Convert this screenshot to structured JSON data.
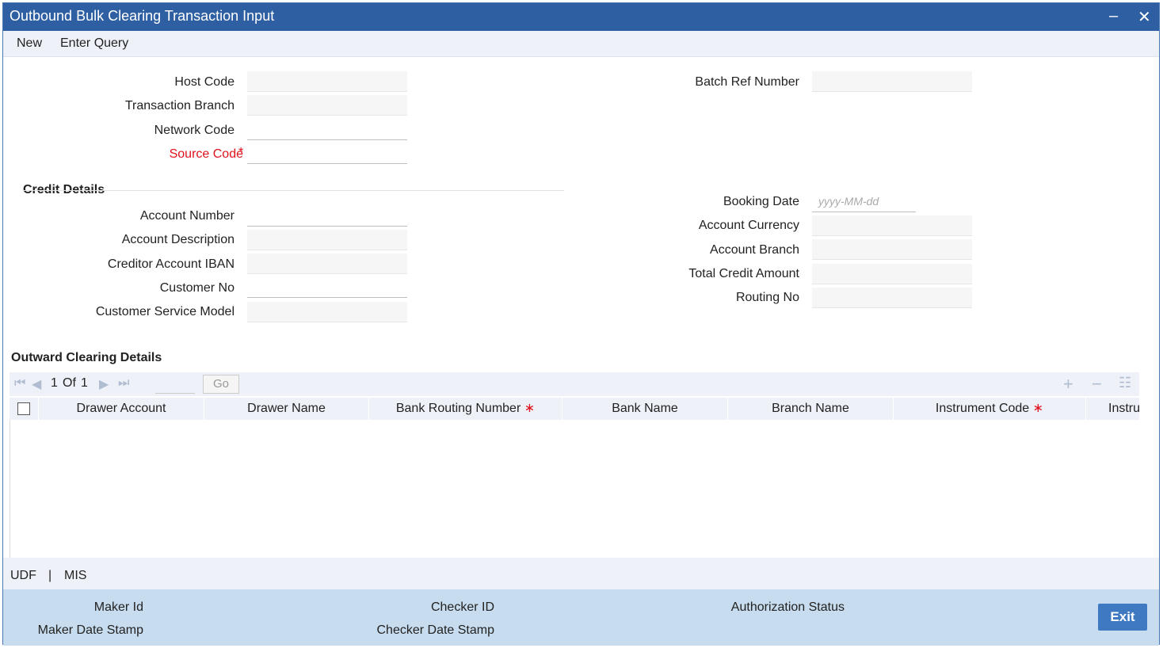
{
  "window": {
    "title": "Outbound Bulk Clearing Transaction Input",
    "minimize": "–",
    "close": "✕"
  },
  "menu": {
    "new": "New",
    "enter_query": "Enter Query"
  },
  "header_fields": {
    "host_code": "Host Code",
    "transaction_branch": "Transaction Branch",
    "network_code": "Network Code",
    "source_code": "Source Code",
    "required_mark": "*",
    "batch_ref_number": "Batch Ref Number"
  },
  "credit": {
    "title": "Credit Details",
    "account_number": "Account Number",
    "account_description": "Account Description",
    "creditor_account_iban": "Creditor Account IBAN",
    "customer_no": "Customer No",
    "customer_service_model": "Customer Service Model",
    "booking_date": "Booking Date",
    "booking_date_placeholder": "yyyy-MM-dd",
    "account_currency": "Account Currency",
    "account_branch": "Account Branch",
    "total_credit_amount": "Total Credit Amount",
    "routing_no": "Routing No"
  },
  "outward": {
    "title": "Outward Clearing Details",
    "pager": {
      "current": "1",
      "of": "Of",
      "total": "1",
      "go": "Go"
    },
    "columns": [
      "Drawer Account",
      "Drawer Name",
      "Bank Routing Number",
      "Bank Name",
      "Branch Name",
      "Instrument Code",
      "Instru"
    ],
    "required_mark": "∗"
  },
  "tabs": {
    "udf": "UDF",
    "sep": "|",
    "mis": "MIS"
  },
  "footer": {
    "maker_id": "Maker Id",
    "maker_date_stamp": "Maker Date Stamp",
    "checker_id": "Checker ID",
    "checker_date_stamp": "Checker Date Stamp",
    "authorization_status": "Authorization Status",
    "exit": "Exit"
  },
  "colors": {
    "titlebar": "#2e5fa3",
    "required": "#e0121d",
    "footer": "#c7dcee",
    "exit_button": "#3e79c2"
  }
}
